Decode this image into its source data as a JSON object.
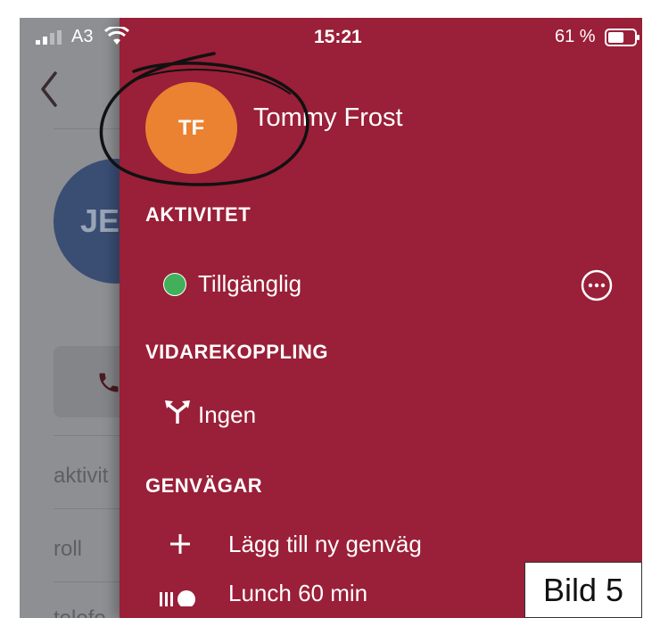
{
  "status_bar": {
    "carrier": "A3",
    "time": "15:21",
    "battery": "61 %",
    "battery_level": 0.61
  },
  "background": {
    "avatar_initials": "JE",
    "rows": [
      "aktivit",
      "roll",
      "telefo"
    ]
  },
  "drawer": {
    "user": {
      "initials": "TF",
      "name": "Tommy Frost"
    },
    "sections": {
      "activity": "AKTIVITET",
      "forwarding": "VIDAREKOPPLING",
      "shortcuts": "GENVÄGAR"
    },
    "activity_status": "Tillgänglig",
    "forwarding_value": "Ingen",
    "add_shortcut": "Lägg till ny genväg",
    "shortcut_1": "Lunch 60 min"
  },
  "colors": {
    "drawer": "#9a1f38",
    "avatar": "#ea8231",
    "status_available": "#42b05a"
  },
  "annotation_label": "Bild 5"
}
